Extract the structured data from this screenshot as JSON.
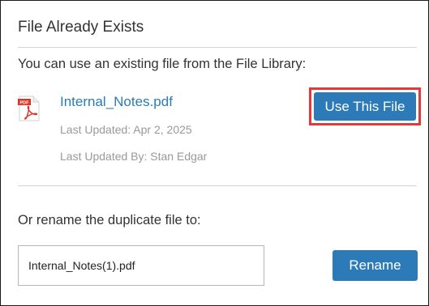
{
  "dialog": {
    "title": "File Already Exists",
    "intro": "You can use an existing file from the File Library:",
    "existing_file": {
      "icon": "pdf-file-icon",
      "icon_badge": "PDF",
      "name": "Internal_Notes.pdf",
      "last_updated": "Last Updated: Apr 2, 2025",
      "last_updated_by": "Last Updated By: Stan Edgar"
    },
    "use_file_button": "Use This File",
    "rename_label": "Or rename the duplicate file to:",
    "rename_input_value": "Internal_Notes(1).pdf",
    "rename_button": "Rename"
  },
  "colors": {
    "accent": "#2c7ab8",
    "link": "#2a7bb8",
    "highlight": "#e23a3a",
    "pdf_red": "#d9362b"
  }
}
